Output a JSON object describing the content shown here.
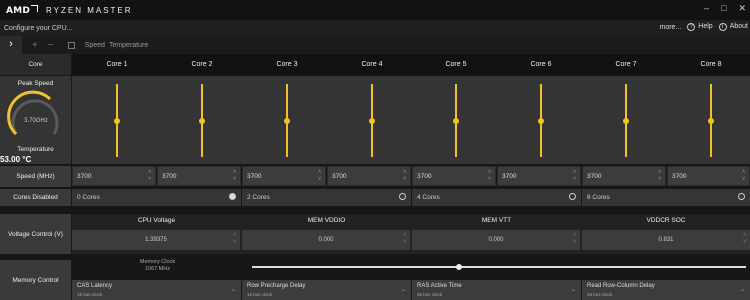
{
  "window": {
    "brand": "AMD",
    "title": "RYZEN MASTER",
    "controls": [
      "–",
      "□",
      "✕"
    ]
  },
  "topbar": {
    "configure": "Configure your CPU...",
    "more": "more...",
    "help": "Help",
    "about": "About"
  },
  "toolbar": {
    "speed": "Speed",
    "temperature": "Temperature"
  },
  "rows": {
    "core": "Core",
    "speed": "Speed (MHz)",
    "cores_disabled": "Cores Disabled",
    "voltage_control": "Voltage Control (V)",
    "memory_control": "Memory Control"
  },
  "cores": [
    "Core 1",
    "Core 2",
    "Core 3",
    "Core 4",
    "Core 5",
    "Core 6",
    "Core 7",
    "Core 8"
  ],
  "core_slider_level": [
    0.5,
    0.5,
    0.5,
    0.5,
    0.5,
    0.5,
    0.5,
    0.5
  ],
  "peak": {
    "label": "Peak Speed",
    "value": "3.70GHz",
    "temp_label": "Temperature",
    "temp": "53.00 °C"
  },
  "speeds": [
    "3700",
    "3700",
    "3700",
    "3700",
    "3700",
    "3700",
    "3700",
    "3700"
  ],
  "disabled": [
    {
      "label": "0 Cores",
      "selected": true
    },
    {
      "label": "2 Cores",
      "selected": false
    },
    {
      "label": "4 Cores",
      "selected": false
    },
    {
      "label": "6 Cores",
      "selected": false
    }
  ],
  "voltage": [
    {
      "name": "CPU Voltage",
      "value": "1.39375"
    },
    {
      "name": "MEM VDDIO",
      "value": "0.000"
    },
    {
      "name": "MEM VTT",
      "value": "0.000"
    },
    {
      "name": "VDDCR SOC",
      "value": "0.831"
    }
  ],
  "memory": {
    "clock_label": "Memory Clock",
    "clock_value": "1067 MHz",
    "clock_level": 0.42,
    "timings": [
      {
        "name": "CAS Latency",
        "sub": "15 bus clock"
      },
      {
        "name": "Row Precharge Delay",
        "sub": "15 bus clock"
      },
      {
        "name": "RAS Active Time",
        "sub": "36 bus clock"
      },
      {
        "name": "Read Row-Column Delay",
        "sub": "15 bus clock"
      }
    ]
  },
  "colors": {
    "accent": "#f0c12b"
  }
}
